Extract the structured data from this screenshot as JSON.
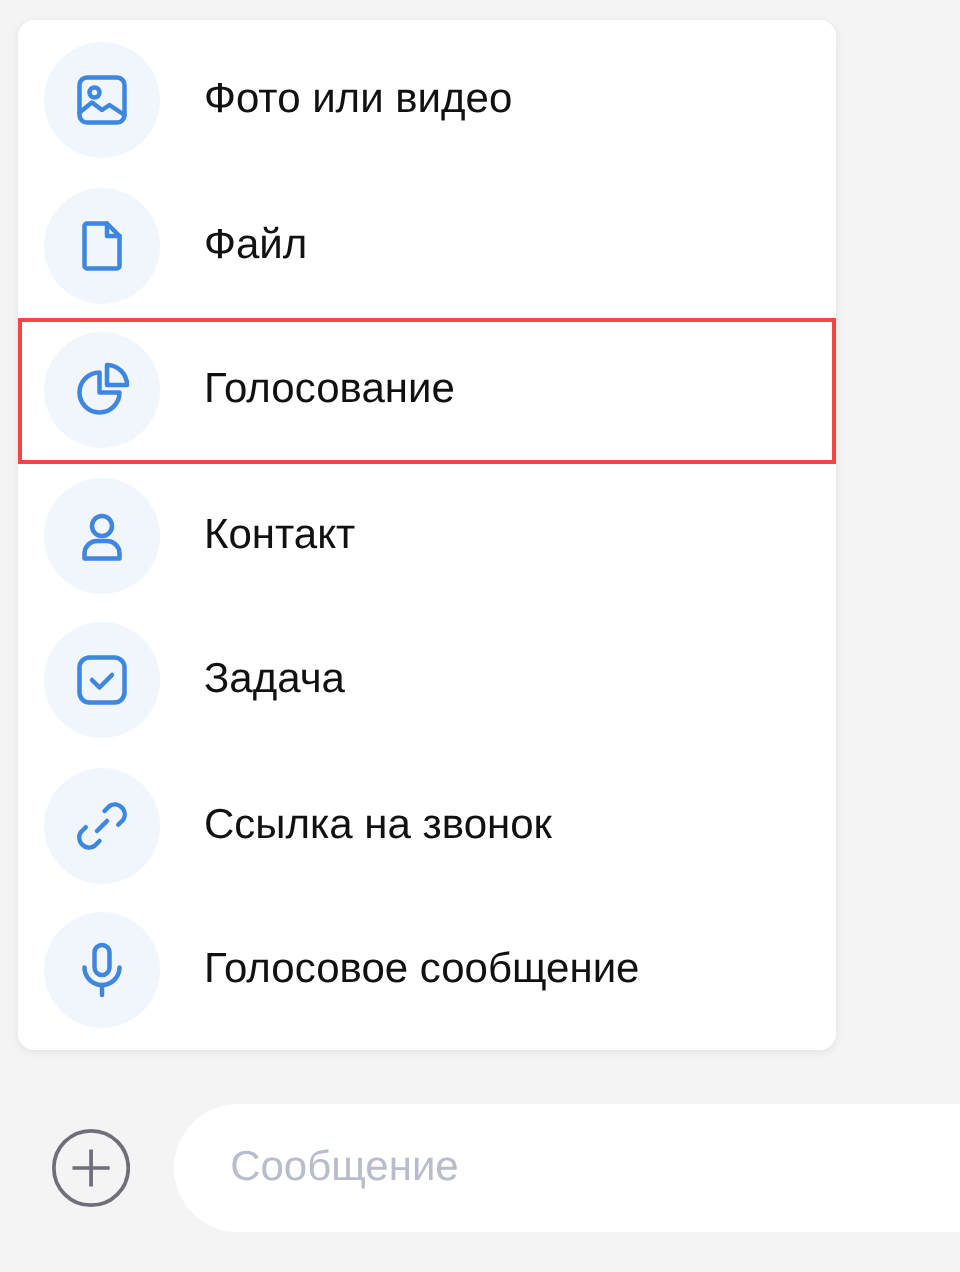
{
  "menu": {
    "items": [
      {
        "label": "Фото или видео",
        "kind": "image",
        "selected": false
      },
      {
        "label": "Файл",
        "kind": "file",
        "selected": false
      },
      {
        "label": "Голосование",
        "kind": "poll",
        "selected": true
      },
      {
        "label": "Контакт",
        "kind": "person",
        "selected": false
      },
      {
        "label": "Задача",
        "kind": "task",
        "selected": false
      },
      {
        "label": "Ссылка на звонок",
        "kind": "link",
        "selected": false
      },
      {
        "label": "Голосовое сообщение",
        "kind": "mic",
        "selected": false
      }
    ]
  },
  "composer": {
    "placeholder": "Сообщение"
  }
}
